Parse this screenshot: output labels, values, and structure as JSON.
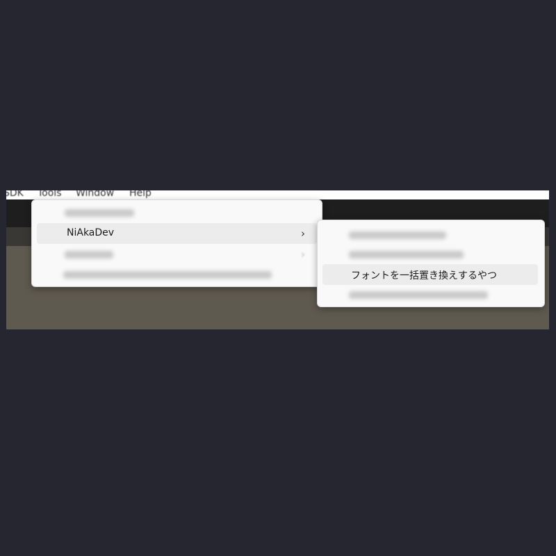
{
  "menubar": {
    "items": [
      {
        "label": "SDK"
      },
      {
        "label": "Tools"
      },
      {
        "label": "Window"
      },
      {
        "label": "Help"
      }
    ]
  },
  "tools_menu": {
    "items": [
      {
        "label": "",
        "redacted": true
      },
      {
        "label": "NiAkaDev",
        "has_submenu": true,
        "highlighted": true
      },
      {
        "label": "",
        "redacted": true,
        "has_submenu": true
      },
      {
        "label": "",
        "redacted": true
      }
    ]
  },
  "niakadev_submenu": {
    "items": [
      {
        "label": "",
        "redacted": true
      },
      {
        "label": "",
        "redacted": true
      },
      {
        "label": "フォントを一括置き換えするやつ",
        "highlighted": true
      },
      {
        "label": "",
        "redacted": true
      }
    ]
  },
  "icons": {
    "submenu_arrow": "chevron-right-icon"
  },
  "colors": {
    "background": "#262631",
    "menu_bg": "#f9f9f9",
    "hover_bg": "#ececec",
    "toolbar": "#1e1e1e",
    "viewport": "#5f5a50"
  }
}
